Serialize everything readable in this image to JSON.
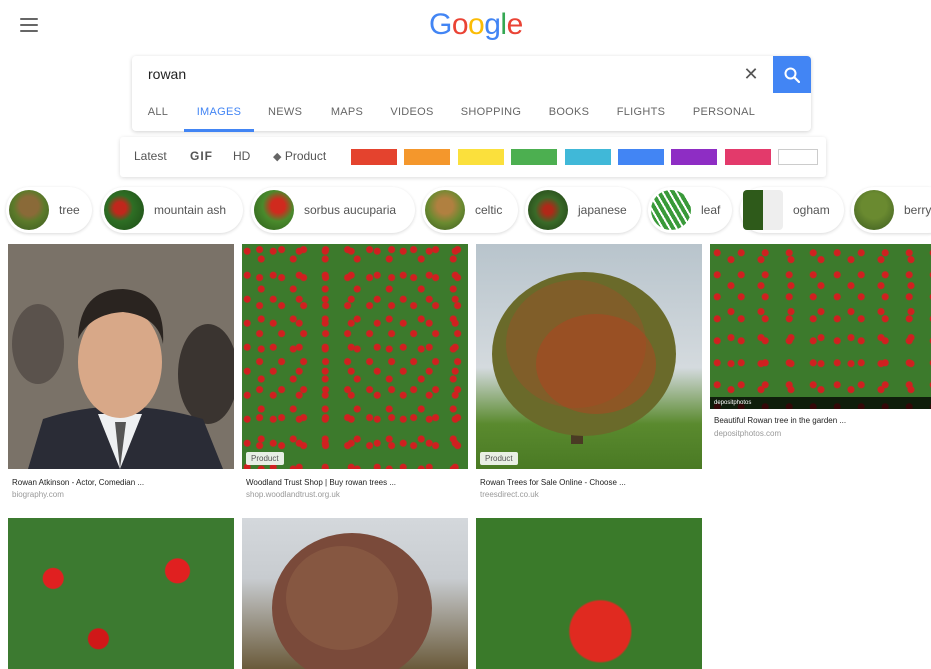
{
  "logo": {
    "letters": [
      "G",
      "o",
      "o",
      "g",
      "l",
      "e"
    ],
    "colors": [
      "#4285f4",
      "#ea4335",
      "#fbbc05",
      "#4285f4",
      "#34a853",
      "#ea4335"
    ]
  },
  "search": {
    "query": "rowan",
    "clear_glyph": "✕"
  },
  "tabs": [
    {
      "label": "ALL",
      "active": false
    },
    {
      "label": "IMAGES",
      "active": true
    },
    {
      "label": "NEWS",
      "active": false
    },
    {
      "label": "MAPS",
      "active": false
    },
    {
      "label": "VIDEOS",
      "active": false
    },
    {
      "label": "SHOPPING",
      "active": false
    },
    {
      "label": "BOOKS",
      "active": false
    },
    {
      "label": "FLIGHTS",
      "active": false
    },
    {
      "label": "PERSONAL",
      "active": false
    }
  ],
  "filters": {
    "latest": "Latest",
    "gif": "GIF",
    "hd": "HD",
    "product": "Product",
    "colors": [
      "#e4432e",
      "#f4972c",
      "#fbe03c",
      "#4caf50",
      "#40b8d8",
      "#4285f4",
      "#8e2dc4",
      "#e33a6b",
      "#ffffff"
    ]
  },
  "chips": [
    {
      "label": "tree"
    },
    {
      "label": "mountain ash"
    },
    {
      "label": "sorbus aucuparia"
    },
    {
      "label": "celtic"
    },
    {
      "label": "japanese"
    },
    {
      "label": "leaf"
    },
    {
      "label": "ogham"
    },
    {
      "label": "berry"
    }
  ],
  "results": [
    {
      "title": "Rowan Atkinson - Actor, Comedian ...",
      "source": "biography.com",
      "badge": ""
    },
    {
      "title": "Woodland Trust Shop | Buy rowan trees ...",
      "source": "shop.woodlandtrust.org.uk",
      "badge": "Product"
    },
    {
      "title": "Rowan Trees for Sale Online - Choose ...",
      "source": "treesdirect.co.uk",
      "badge": "Product"
    },
    {
      "title": "Beautiful Rowan tree in the garden ...",
      "source": "depositphotos.com",
      "badge": "",
      "watermark": "depositphotos"
    },
    {
      "title": "",
      "source": "",
      "badge": ""
    },
    {
      "title": "",
      "source": "",
      "badge": ""
    },
    {
      "title": "",
      "source": "",
      "badge": ""
    }
  ]
}
